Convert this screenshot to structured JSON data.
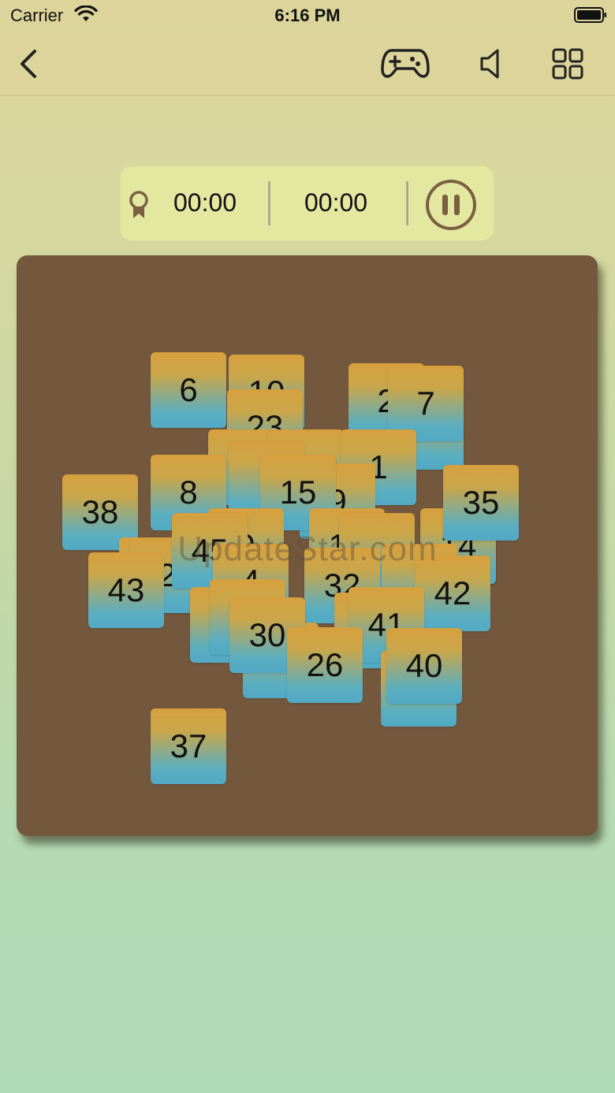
{
  "status_bar": {
    "carrier": "Carrier",
    "time": "6:16 PM"
  },
  "nav": {
    "back_icon": "chevron-left-icon",
    "controller_icon": "gamepad-icon",
    "sound_icon": "speaker-icon",
    "grid_icon": "grid-icon"
  },
  "timer": {
    "best_time": "00:00",
    "current_time": "00:00",
    "pause_icon": "pause-icon"
  },
  "watermark": "UpdateStar.com",
  "colors": {
    "board": "#73583e",
    "tile_top": "#d7a03e",
    "tile_bottom": "#52a9c4",
    "accent": "#7a6040",
    "panel": "#e3e7a0"
  },
  "tiles": [
    {
      "label": ""
    },
    {
      "label": "10"
    },
    {
      "label": "6"
    },
    {
      "label": "23"
    },
    {
      "label": ""
    },
    {
      "label": "2"
    },
    {
      "label": "7"
    },
    {
      "label": ""
    },
    {
      "label": ""
    },
    {
      "label": "1"
    },
    {
      "label": "8"
    },
    {
      "label": ""
    },
    {
      "label": "9"
    },
    {
      "label": "15"
    },
    {
      "label": "38"
    },
    {
      "label": "35"
    },
    {
      "label": ""
    },
    {
      "label": "14"
    },
    {
      "label": ""
    },
    {
      "label": "2"
    },
    {
      "label": "9"
    },
    {
      "label": "45"
    },
    {
      "label": "16"
    },
    {
      "label": ""
    },
    {
      "label": "4"
    },
    {
      "label": "32"
    },
    {
      "label": "43"
    },
    {
      "label": "42"
    },
    {
      "label": ""
    },
    {
      "label": ""
    },
    {
      "label": ""
    },
    {
      "label": "41"
    },
    {
      "label": "30"
    },
    {
      "label": ""
    },
    {
      "label": "40"
    },
    {
      "label": "26"
    },
    {
      "label": "37"
    }
  ]
}
